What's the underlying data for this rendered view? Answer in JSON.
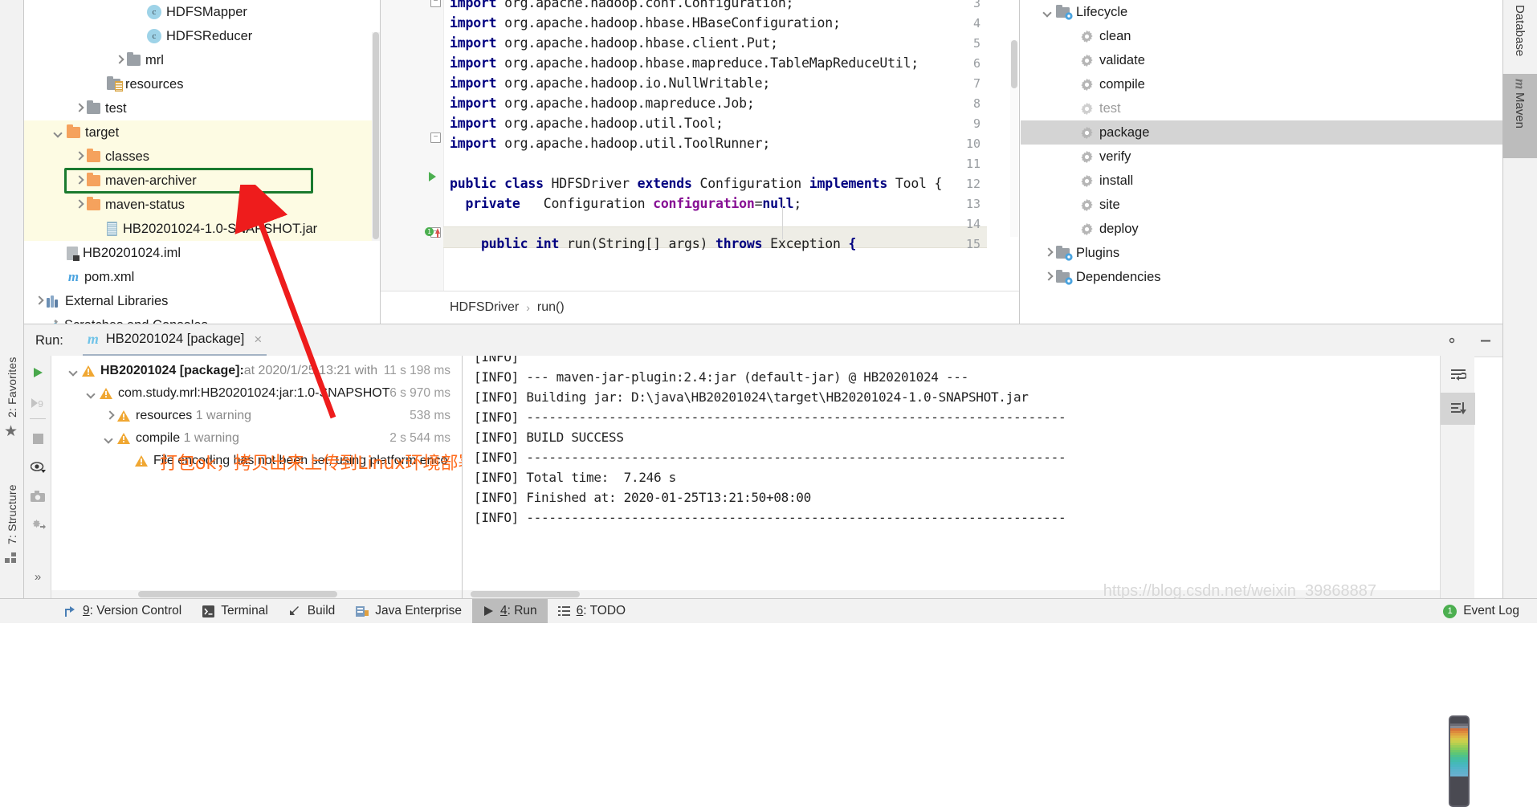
{
  "left_strip": {
    "tabs": [
      {
        "name": "favorites",
        "label": "2: Favorites",
        "number": "2"
      },
      {
        "name": "structure",
        "label": "7: Structure",
        "number": "7"
      }
    ]
  },
  "project_tree": {
    "rows": [
      {
        "indent": 5,
        "arrow": "none",
        "icon": "class-badge",
        "label": "HDFSMapper"
      },
      {
        "indent": 5,
        "arrow": "none",
        "icon": "class-badge",
        "label": "HDFSReducer"
      },
      {
        "indent": 4,
        "arrow": "right",
        "icon": "folder-gray",
        "label": "mrl"
      },
      {
        "indent": 3,
        "arrow": "none",
        "icon": "folder-resources",
        "label": "resources"
      },
      {
        "indent": 2,
        "arrow": "right",
        "icon": "folder-gray",
        "label": "test"
      },
      {
        "indent": 1,
        "arrow": "down",
        "icon": "folder-orange",
        "label": "target"
      },
      {
        "indent": 2,
        "arrow": "right",
        "icon": "folder-orange",
        "label": "classes"
      },
      {
        "indent": 2,
        "arrow": "right",
        "icon": "folder-orange",
        "label": "maven-archiver"
      },
      {
        "indent": 2,
        "arrow": "right",
        "icon": "folder-orange",
        "label": "maven-status"
      },
      {
        "indent": 3,
        "arrow": "none",
        "icon": "jar-file",
        "label": "HB20201024-1.0-SNAPSHOT.jar"
      },
      {
        "indent": 1,
        "arrow": "none",
        "icon": "iml-file",
        "label": "HB20201024.iml"
      },
      {
        "indent": 1,
        "arrow": "none",
        "icon": "maven-m",
        "label": "pom.xml"
      },
      {
        "indent": 0,
        "arrow": "right",
        "icon": "library",
        "label": "External Libraries"
      },
      {
        "indent": 0,
        "arrow": "none",
        "icon": "scratches",
        "label": "Scratches and Consoles"
      }
    ],
    "selected_label": "HB20201024-1.0-SNAPSHOT.jar",
    "highlight_color": "#fdfbe3",
    "selection_box_color": "#1a7a2e"
  },
  "editor": {
    "lines": [
      {
        "num": "3",
        "text": "import org.apache.hadoop.conf.Configuration;",
        "kw": "import"
      },
      {
        "num": "4",
        "text": "import org.apache.hadoop.hbase.HBaseConfiguration;",
        "kw": "import"
      },
      {
        "num": "5",
        "text": "import org.apache.hadoop.hbase.client.Put;",
        "kw": "import"
      },
      {
        "num": "6",
        "text": "import org.apache.hadoop.hbase.mapreduce.TableMapReduceUtil;",
        "kw": "import"
      },
      {
        "num": "7",
        "text": "import org.apache.hadoop.io.NullWritable;",
        "kw": "import"
      },
      {
        "num": "8",
        "text": "import org.apache.hadoop.mapreduce.Job;",
        "kw": "import"
      },
      {
        "num": "9",
        "text": "import org.apache.hadoop.util.Tool;",
        "kw": "import"
      },
      {
        "num": "10",
        "text": "import org.apache.hadoop.util.ToolRunner;",
        "kw": "import"
      },
      {
        "num": "11",
        "text": ""
      },
      {
        "num": "12",
        "text": "public class HDFSDriver extends Configuration implements Tool {"
      },
      {
        "num": "13",
        "text": "  private   Configuration configuration=null;"
      },
      {
        "num": "14",
        "text": ""
      },
      {
        "num": "15",
        "text": "    public int run(String[] args) throws Exception {"
      }
    ],
    "breadcrumb": [
      "HDFSDriver",
      "run()"
    ],
    "breadcrumb_separator": "›"
  },
  "maven": {
    "rows": [
      {
        "indent": 0,
        "arrow": "down",
        "icon": "phase-folder",
        "label": "Lifecycle",
        "state": "normal"
      },
      {
        "indent": 1,
        "arrow": "none",
        "icon": "gear",
        "label": "clean",
        "state": "normal"
      },
      {
        "indent": 1,
        "arrow": "none",
        "icon": "gear",
        "label": "validate",
        "state": "normal"
      },
      {
        "indent": 1,
        "arrow": "none",
        "icon": "gear",
        "label": "compile",
        "state": "normal"
      },
      {
        "indent": 1,
        "arrow": "none",
        "icon": "gear",
        "label": "test",
        "state": "dim"
      },
      {
        "indent": 1,
        "arrow": "none",
        "icon": "gear",
        "label": "package",
        "state": "selected"
      },
      {
        "indent": 1,
        "arrow": "none",
        "icon": "gear",
        "label": "verify",
        "state": "normal"
      },
      {
        "indent": 1,
        "arrow": "none",
        "icon": "gear",
        "label": "install",
        "state": "normal"
      },
      {
        "indent": 1,
        "arrow": "none",
        "icon": "gear",
        "label": "site",
        "state": "normal"
      },
      {
        "indent": 1,
        "arrow": "none",
        "icon": "gear",
        "label": "deploy",
        "state": "normal"
      },
      {
        "indent": 0,
        "arrow": "right",
        "icon": "phase-folder",
        "label": "Plugins",
        "state": "normal"
      },
      {
        "indent": 0,
        "arrow": "right",
        "icon": "phase-folder",
        "label": "Dependencies",
        "state": "normal"
      }
    ],
    "selected_label": "package"
  },
  "right_strip": {
    "tabs": [
      {
        "name": "database",
        "label": "Database",
        "active": false
      },
      {
        "name": "maven",
        "label": "Maven",
        "active": true,
        "icon": "maven-m-icon"
      }
    ]
  },
  "run_window": {
    "title": "Run:",
    "tab": {
      "label": "HB20201024 [package]",
      "close": "×",
      "icon": "maven-m-icon"
    },
    "toolbar": [
      {
        "name": "rerun-button",
        "icon": "play-icon"
      },
      {
        "name": "rerun-failed-button",
        "icon": "rerun-failed-icon"
      },
      {
        "name": "stop-button",
        "icon": "stop-icon"
      },
      {
        "name": "filter-button",
        "icon": "eye-icon"
      },
      {
        "name": "export-button",
        "icon": "camera-icon"
      },
      {
        "name": "toggle-tasks-button",
        "icon": "tasks-icon"
      },
      {
        "name": "more-button",
        "icon": "chevron-double-right-icon"
      }
    ],
    "header_buttons": [
      {
        "name": "settings-button",
        "icon": "gear-icon"
      },
      {
        "name": "hide-button",
        "icon": "minimize-icon"
      }
    ],
    "console_toolbar": [
      {
        "name": "soft-wrap-button",
        "icon": "wrap-icon",
        "selected": false
      },
      {
        "name": "scroll-to-end-button",
        "icon": "scroll-end-icon",
        "selected": true
      }
    ],
    "build_tree": [
      {
        "indent": 0,
        "arrow": "down",
        "bold_label": "HB20201024 [package]:",
        "label": " at 2020/1/25 13:21 with ",
        "duration": "11 s 198 ms"
      },
      {
        "indent": 1,
        "arrow": "down",
        "bold_label": "",
        "label": "com.study.mrl:HB20201024:jar:1.0-SNAPSHOT",
        "duration": "6 s 970 ms"
      },
      {
        "indent": 2,
        "arrow": "right",
        "bold_label": "",
        "label": "resources  1 warning",
        "duration": "538 ms"
      },
      {
        "indent": 2,
        "arrow": "down",
        "bold_label": "",
        "label": "compile  1 warning",
        "duration": "2 s 544 ms"
      },
      {
        "indent": 3,
        "arrow": "none",
        "bold_label": "",
        "label": "File encoding has not been set, using platform enco",
        "duration": ""
      }
    ],
    "annotation": "打包ok，拷贝出来上传到Linux环境部署",
    "annotation_color": "#ff6a1a",
    "console_lines": [
      "[INFO]",
      "[INFO] --- maven-jar-plugin:2.4:jar (default-jar) @ HB20201024 ---",
      "[INFO] Building jar: D:\\java\\HB20201024\\target\\HB20201024-1.0-SNAPSHOT.jar",
      "[INFO] ------------------------------------------------------------------------",
      "[INFO] BUILD SUCCESS",
      "[INFO] ------------------------------------------------------------------------",
      "[INFO] Total time:  7.246 s",
      "[INFO] Finished at: 2020-01-25T13:21:50+08:00",
      "[INFO] ------------------------------------------------------------------------"
    ]
  },
  "statusbar": {
    "items": [
      {
        "name": "version-control",
        "label": "9: Version Control",
        "number": "9",
        "icon": "vcs-icon",
        "active": false
      },
      {
        "name": "terminal",
        "label": "Terminal",
        "icon": "terminal-icon",
        "active": false
      },
      {
        "name": "build",
        "label": "Build",
        "icon": "build-icon",
        "active": false
      },
      {
        "name": "java-enterprise",
        "label": "Java Enterprise",
        "icon": "java-ee-icon",
        "active": false
      },
      {
        "name": "run",
        "label": "4: Run",
        "number": "4",
        "icon": "play-icon",
        "active": true
      },
      {
        "name": "todo",
        "label": "6: TODO",
        "number": "6",
        "icon": "todo-icon",
        "active": false
      }
    ],
    "event_log": {
      "label": "Event Log",
      "badge": "1"
    }
  },
  "watermark": "https://blog.csdn.net/weixin_39868887"
}
